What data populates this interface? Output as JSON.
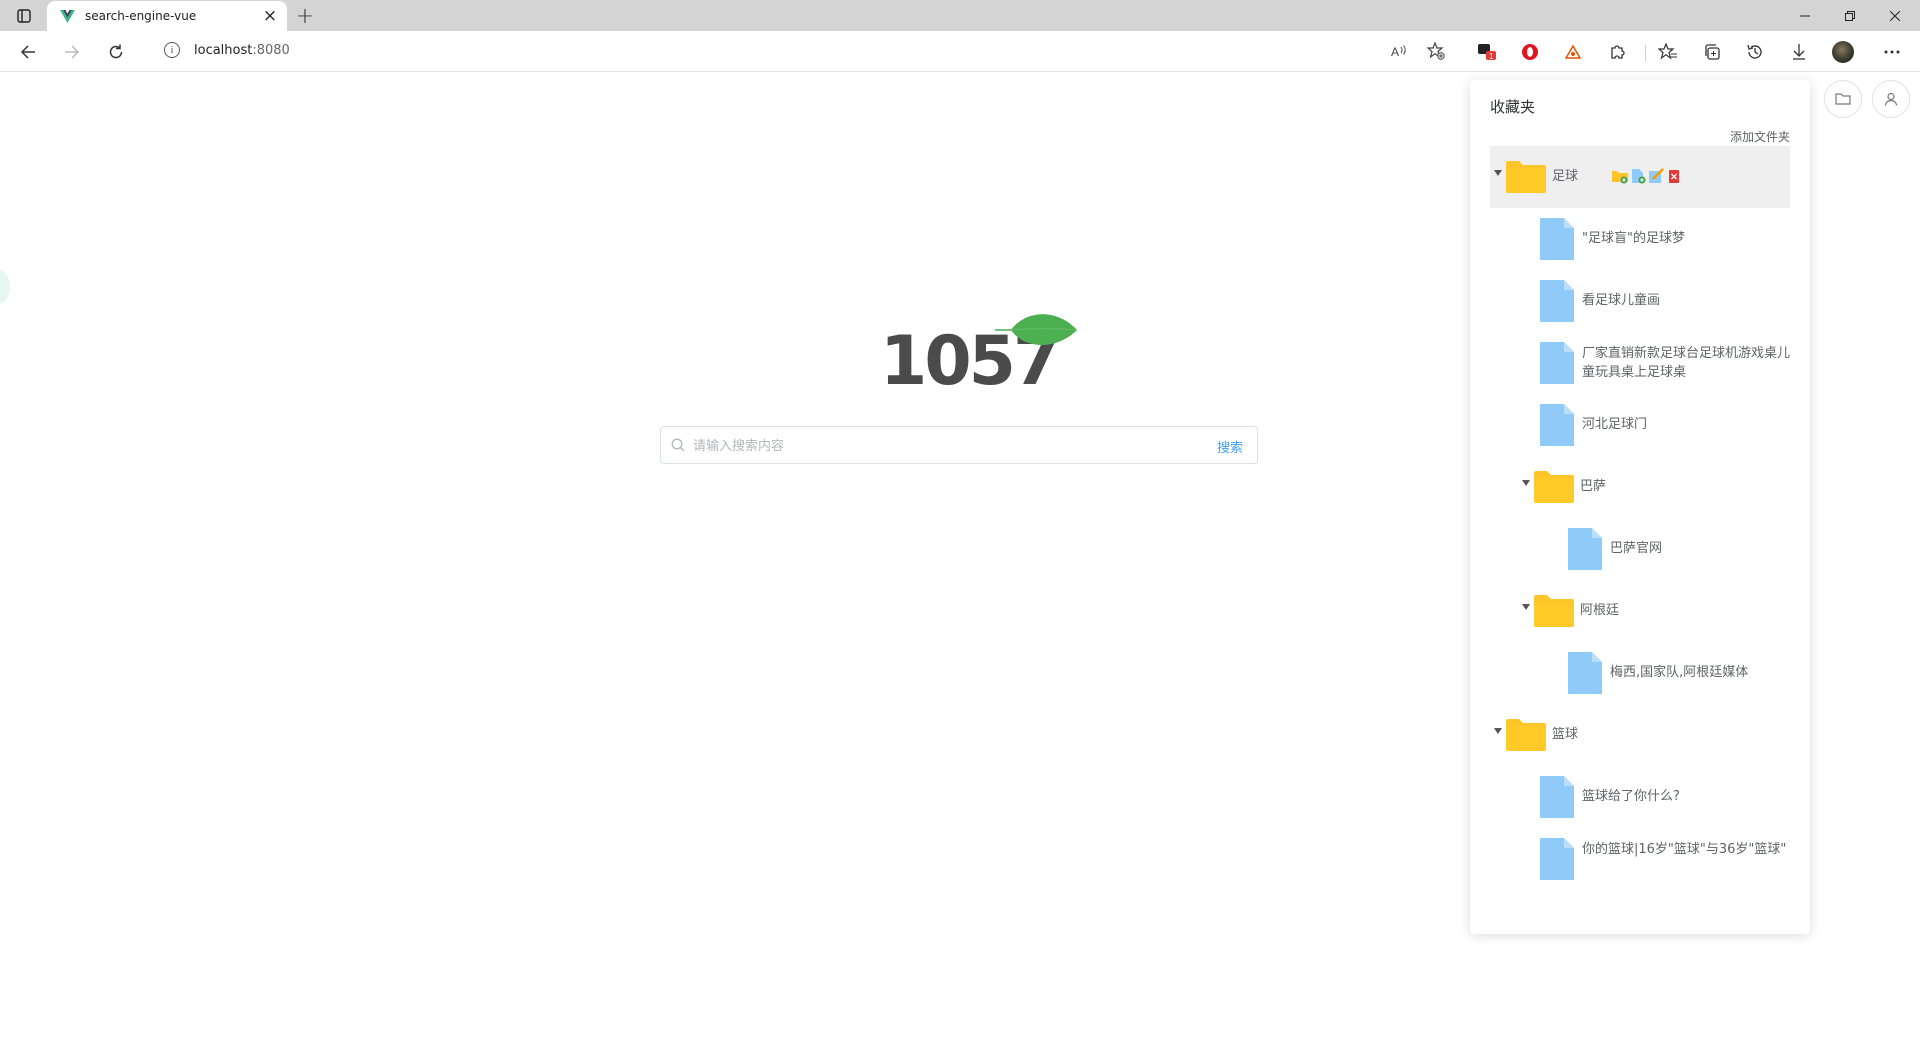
{
  "browser": {
    "tab_title": "search-engine-vue",
    "new_tab": "+",
    "close_tab": "×",
    "url_host": "localhost",
    "url_port": ":8080",
    "extension_badge": "1"
  },
  "page": {
    "logo_text": "1057",
    "search_placeholder": "请输入搜索内容",
    "search_button": "搜索"
  },
  "favorites": {
    "title": "收藏夹",
    "add_folder": "添加文件夹",
    "tree": [
      {
        "type": "folder",
        "label": "足球",
        "expanded": true,
        "selected": true
      },
      {
        "type": "file",
        "label": "\"足球盲\"的足球梦"
      },
      {
        "type": "file",
        "label": "看足球儿童画"
      },
      {
        "type": "file",
        "label": "厂家直销新款足球台足球机游戏桌儿童玩具桌上足球桌"
      },
      {
        "type": "file",
        "label": "河北足球门"
      },
      {
        "type": "folder",
        "label": "巴萨",
        "expanded": true
      },
      {
        "type": "file",
        "label": "巴萨官网"
      },
      {
        "type": "folder",
        "label": "阿根廷",
        "expanded": true
      },
      {
        "type": "file",
        "label": "梅西,国家队,阿根廷媒体"
      },
      {
        "type": "folder",
        "label": "篮球",
        "expanded": true
      },
      {
        "type": "file",
        "label": "篮球给了你什么?"
      },
      {
        "type": "file",
        "label": "你的篮球|16岁\"篮球\"与36岁\"篮球\""
      }
    ]
  },
  "colors": {
    "accent": "#409eff",
    "folder": "#ffc529",
    "file": "#90caf9",
    "leaf": "#4caf50"
  }
}
